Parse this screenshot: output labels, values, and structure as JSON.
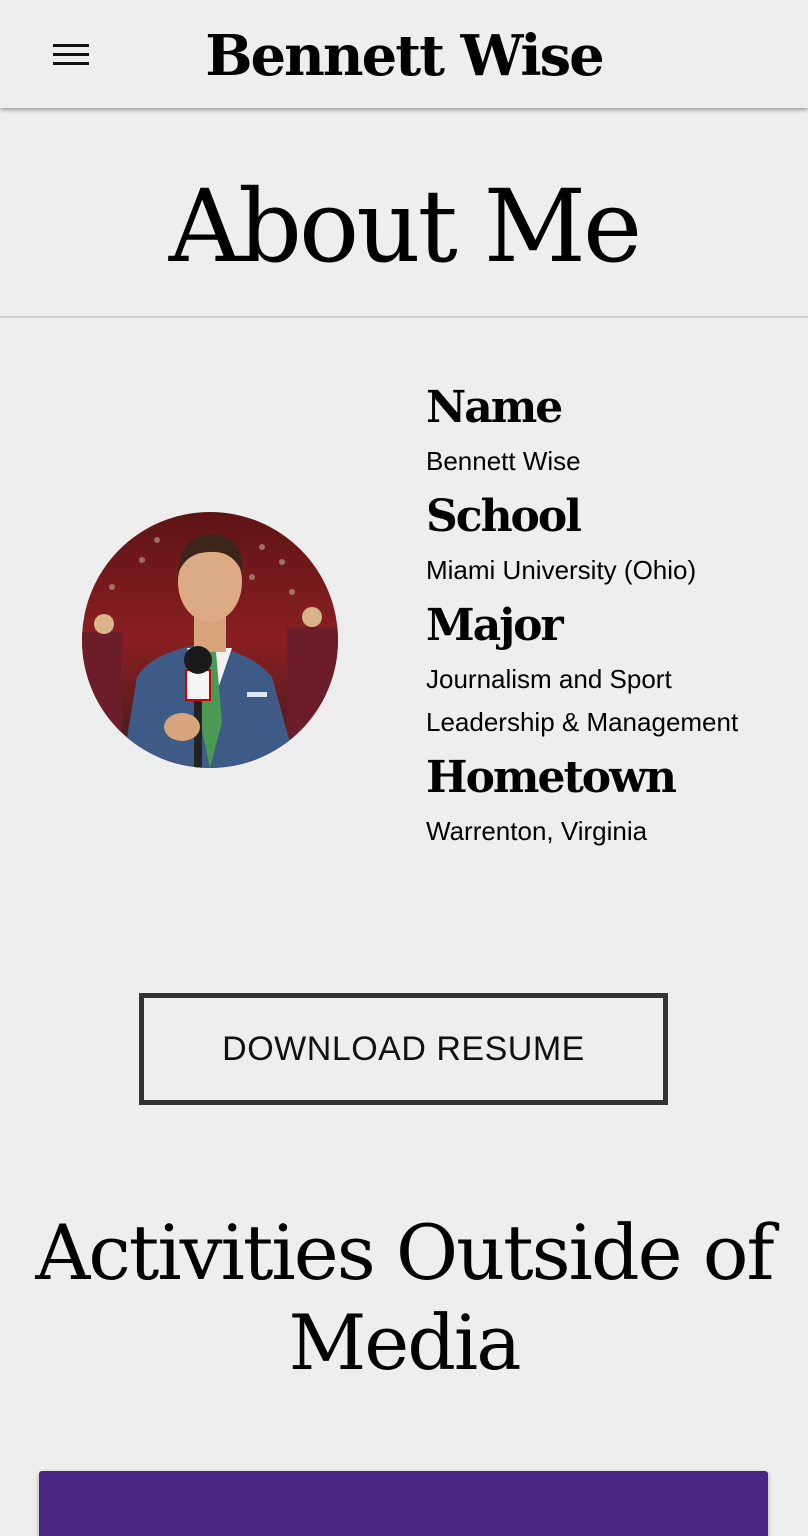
{
  "nav": {
    "brand": "Bennett Wise",
    "menu_icon": "hamburger-menu-icon"
  },
  "page": {
    "title": "About Me"
  },
  "profile": {
    "photo_alt": "Bennett Wise holding an ESPN microphone on a basketball court",
    "items": [
      {
        "heading": "Name",
        "value": "Bennett Wise"
      },
      {
        "heading": "School",
        "value": "Miami University (Ohio)"
      },
      {
        "heading": "Major",
        "value": "Journalism and Sport Leadership & Management"
      },
      {
        "heading": "Hometown",
        "value": "Warrenton, Virginia"
      }
    ]
  },
  "resume": {
    "label": "DOWNLOAD RESUME"
  },
  "activities": {
    "title": "Activities Outside of Media"
  },
  "colors": {
    "background": "#eeeeee",
    "card_purple": "#4b2583",
    "button_border": "#333333"
  }
}
